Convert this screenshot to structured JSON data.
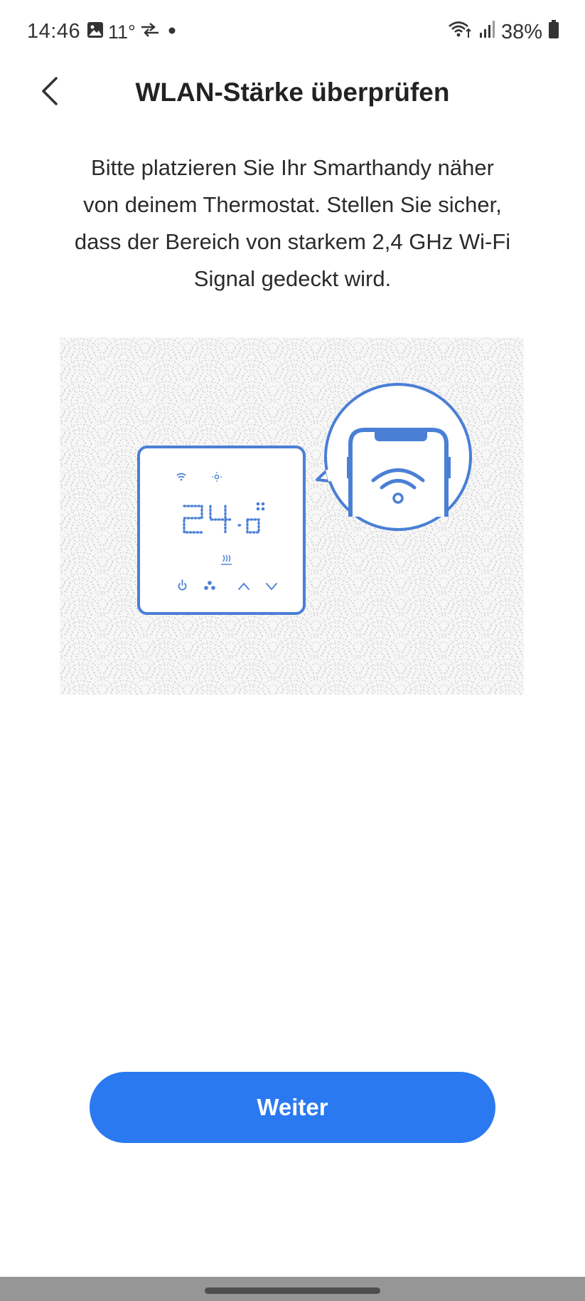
{
  "status_bar": {
    "time": "14:46",
    "temperature": "11°",
    "battery": "38%",
    "icons": [
      "image-icon",
      "sync-arrows-icon",
      "notification-dot-icon",
      "wifi-icon",
      "signal-icon",
      "battery-icon"
    ]
  },
  "header": {
    "title": "WLAN-Stärke überprüfen",
    "back_icon": "chevron-left-icon"
  },
  "description": {
    "line1": "Bitte platzieren Sie Ihr Smarthandy näher",
    "line2": "von deinem Thermostat. Stellen Sie sicher,",
    "line3": "dass der Bereich von starkem 2,4 GHz Wi-Fi",
    "line4": "Signal gedeckt wird."
  },
  "illustration": {
    "thermostat_display": "24.0",
    "accent_color": "#4a7fd6",
    "icons": [
      "thermostat-icon",
      "phone-wifi-icon"
    ]
  },
  "actions": {
    "next_label": "Weiter"
  },
  "colors": {
    "primary": "#2a79f1",
    "illustration_blue": "#4a7fd6",
    "pattern": "#d2d2d2"
  }
}
